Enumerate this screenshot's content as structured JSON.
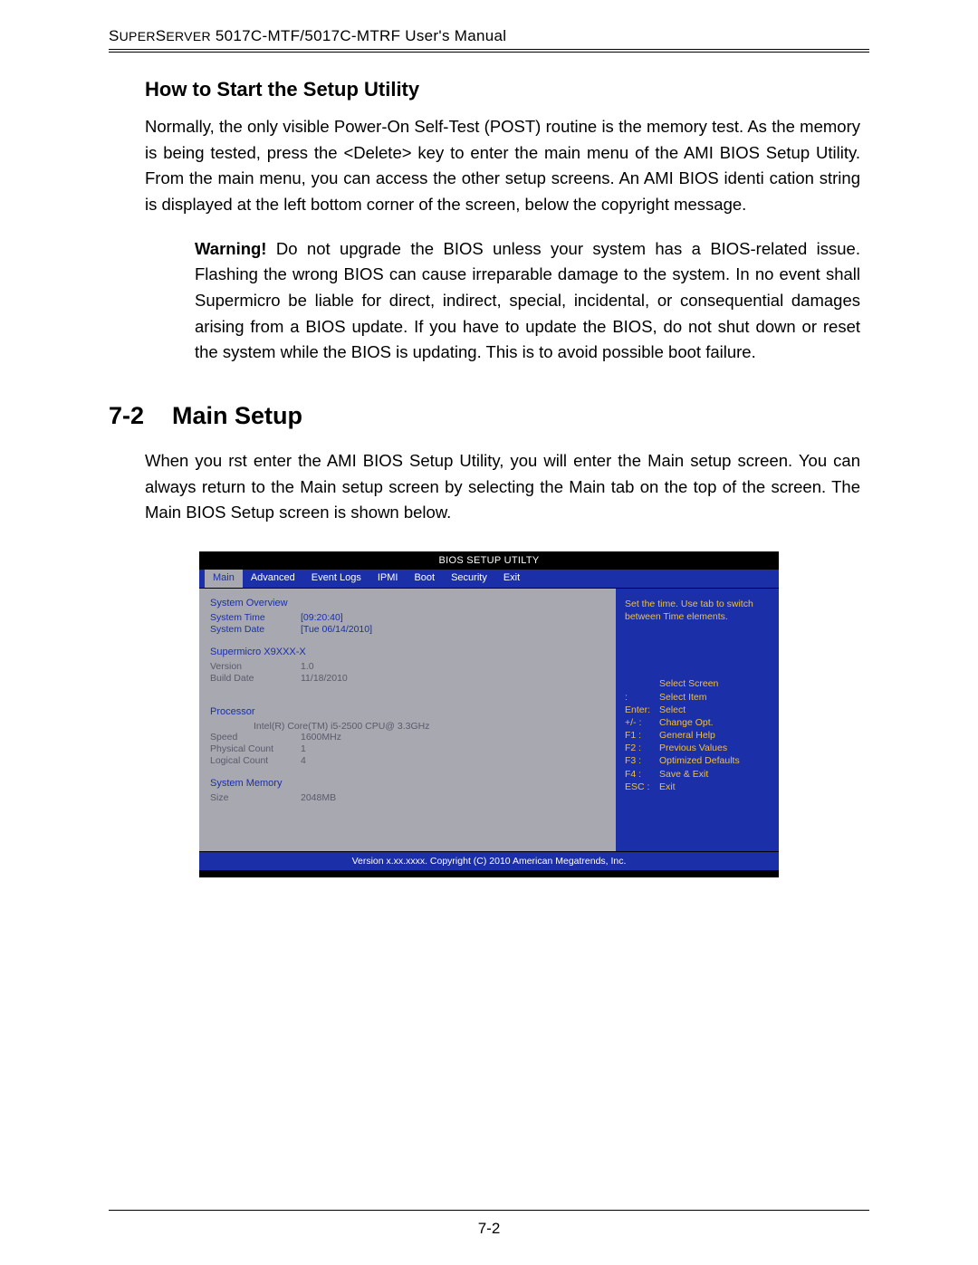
{
  "header": "SUPERSERVER 5017C-MTF/5017C-MTRF User's Manual",
  "subtitle1": "How to Start the Setup Utility",
  "para1": "Normally, the only visible Power-On Self-Test (POST) routine is the memory test. As the memory is being tested, press the <Delete> key to enter the main menu of the AMI BIOS Setup Utility. From the main menu, you can access the other setup screens. An AMI BIOS identi cation string is displayed at the left bottom corner of the screen, below the copyright message.",
  "warning_label": "Warning!",
  "warning_body": " Do not upgrade the BIOS unless your system has a BIOS-related issue. Flashing the wrong BIOS can cause irreparable damage to the system. In no event shall Supermicro be liable for direct, indirect, special, incidental, or consequential damages arising from a BIOS update. If you have to update the BIOS, do not shut down or reset the system while the BIOS is updating. This is to avoid possible boot failure.",
  "section_num": "7-2",
  "section_title": "Main Setup",
  "para2": "When you  rst enter the AMI BIOS Setup Utility, you will enter the Main setup screen. You can always return to the Main setup screen by selecting the Main tab on the top of the screen. The Main BIOS Setup screen is shown below.",
  "page_number": "7-2",
  "bios": {
    "title": "BIOS SETUP UTILTY",
    "tabs": [
      "Main",
      "Advanced",
      "Event Logs",
      "IPMI",
      "Boot",
      "Security",
      "Exit"
    ],
    "active_tab": "Main",
    "overview_head": "System Overview",
    "fields": {
      "system_time_label": "System Time",
      "system_time_val": "[09:20:40]",
      "system_date_label": "System Date",
      "system_date_val": "[Tue 06/14/2010]",
      "board": "Supermicro X9XXX-X",
      "version_label": "Version",
      "version_val": "1.0",
      "build_label": "Build Date",
      "build_val": "11/18/2010",
      "proc_head": "Processor",
      "cpu": "Intel(R)  Core(TM) i5-2500 CPU@ 3.3GHz",
      "speed_label": "Speed",
      "speed_val": "1600MHz",
      "pcount_label": "Physical Count",
      "pcount_val": "1",
      "lcount_label": "Logical Count",
      "lcount_val": "4",
      "mem_head": "System Memory",
      "size_label": "Size",
      "size_val": "2048MB"
    },
    "help_top": "Set the time.  Use tab to switch between Time elements.",
    "keys": [
      {
        "k": "",
        "a": "Select Screen"
      },
      {
        "k": ":",
        "a": "Select Item"
      },
      {
        "k": "Enter:",
        "a": "Select"
      },
      {
        "k": "+/-  :",
        "a": "Change Opt."
      },
      {
        "k": "F1 :",
        "a": "General Help"
      },
      {
        "k": "F2 :",
        "a": "Previous Values"
      },
      {
        "k": "F3 :",
        "a": "Optimized Defaults"
      },
      {
        "k": "F4 :",
        "a": "Save & Exit"
      },
      {
        "k": "ESC :",
        "a": "Exit"
      }
    ],
    "footer": "Version x.xx.xxxx. Copyright (C) 2010 American Megatrends, Inc."
  }
}
